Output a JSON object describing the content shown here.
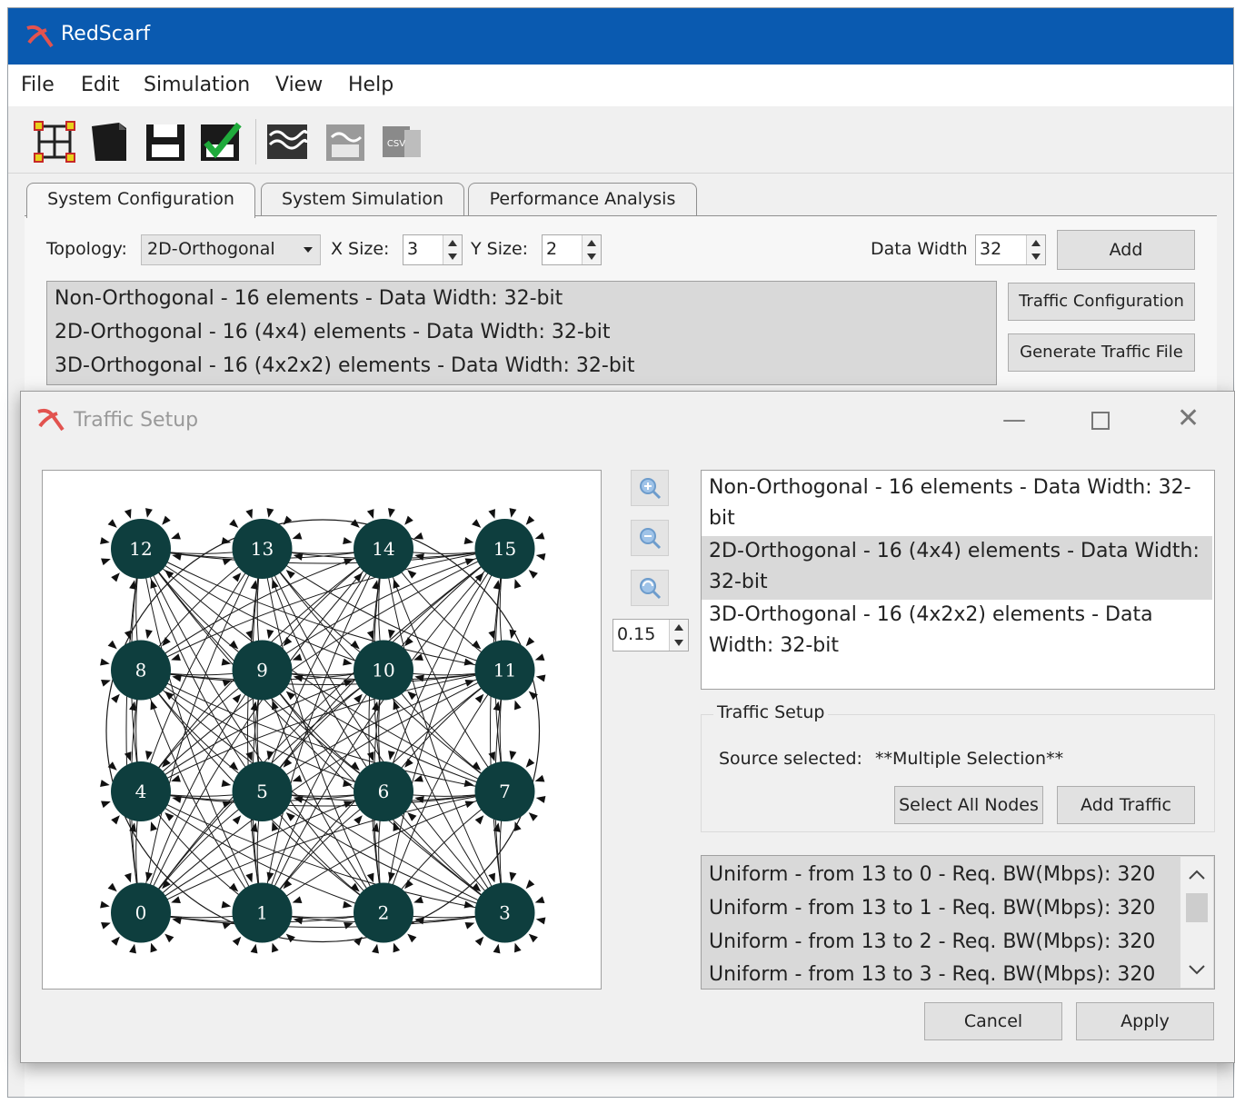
{
  "app": {
    "title": "RedScarf",
    "brand_color": "#0a5ab0"
  },
  "menu": [
    "File",
    "Edit",
    "Simulation",
    "View",
    "Help"
  ],
  "toolbar": {
    "icons": [
      "network-topology-icon",
      "new-document-icon",
      "save-icon",
      "save-checked-icon",
      "import-icon",
      "export-icon",
      "csv-export-icon"
    ],
    "csv_label": "CSV"
  },
  "tabs": [
    "System Configuration",
    "System Simulation",
    "Performance Analysis"
  ],
  "config": {
    "topology_label": "Topology:",
    "topology_value": "2D-Orthogonal",
    "x_size_label": "X Size:",
    "x_size_value": "3",
    "y_size_label": "Y Size:",
    "y_size_value": "2",
    "data_width_label": "Data Width",
    "data_width_value": "32",
    "add_label": "Add",
    "traffic_configuration_label": "Traffic Configuration",
    "generate_traffic_file_label": "Generate Traffic File",
    "systems": [
      "Non-Orthogonal - 16 elements - Data Width: 32-bit",
      "2D-Orthogonal - 16 (4x4) elements - Data Width: 32-bit",
      "3D-Orthogonal - 16 (4x2x2) elements - Data Width: 32-bit"
    ]
  },
  "dialog": {
    "title": "Traffic Setup",
    "zoom_value": "0.15",
    "systems": [
      [
        "Non-Orthogonal - 16 elements - Data Width: 32-",
        "bit"
      ],
      [
        "2D-Orthogonal - 16 (4x4) elements - Data Width:",
        "32-bit"
      ],
      [
        "3D-Orthogonal - 16 (4x2x2) elements - Data",
        "Width: 32-bit"
      ]
    ],
    "traffic_setup_legend": "Traffic Setup",
    "source_selected_label": "Source selected:",
    "source_selected_value": "**Multiple Selection**",
    "select_all_label": "Select All Nodes",
    "add_traffic_label": "Add Traffic",
    "traffic_items": [
      "Uniform - from 13 to 0 - Req. BW(Mbps): 320",
      "Uniform - from 13 to 1 - Req. BW(Mbps): 320",
      "Uniform - from 13 to 2 - Req. BW(Mbps): 320",
      "Uniform - from 13 to 3 - Req. BW(Mbps): 320"
    ],
    "cancel_label": "Cancel",
    "apply_label": "Apply"
  },
  "graph": {
    "node_color": "#0e3e3e",
    "nodes": [
      {
        "id": "12",
        "col": 0,
        "row": 0
      },
      {
        "id": "13",
        "col": 1,
        "row": 0
      },
      {
        "id": "14",
        "col": 2,
        "row": 0
      },
      {
        "id": "15",
        "col": 3,
        "row": 0
      },
      {
        "id": "8",
        "col": 0,
        "row": 1
      },
      {
        "id": "9",
        "col": 1,
        "row": 1
      },
      {
        "id": "10",
        "col": 2,
        "row": 1
      },
      {
        "id": "11",
        "col": 3,
        "row": 1
      },
      {
        "id": "4",
        "col": 0,
        "row": 2
      },
      {
        "id": "5",
        "col": 1,
        "row": 2
      },
      {
        "id": "6",
        "col": 2,
        "row": 2
      },
      {
        "id": "7",
        "col": 3,
        "row": 2
      },
      {
        "id": "0",
        "col": 0,
        "row": 3
      },
      {
        "id": "1",
        "col": 1,
        "row": 3
      },
      {
        "id": "2",
        "col": 2,
        "row": 3
      },
      {
        "id": "3",
        "col": 3,
        "row": 3
      }
    ]
  }
}
